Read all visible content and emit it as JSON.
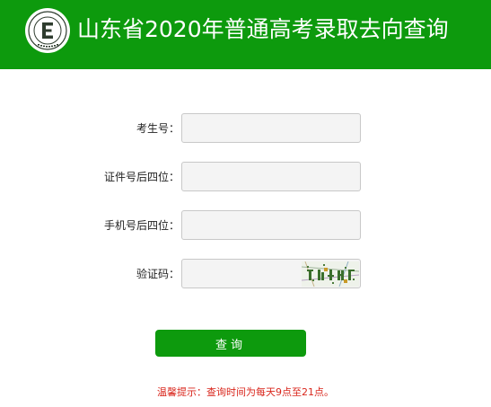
{
  "header": {
    "title": "山东省2020年普通高考录取去向查询",
    "logo_icon": "exam-authority-logo",
    "background_color": "#0d9a0d"
  },
  "form": {
    "fields": [
      {
        "label": "考生号：",
        "value": ""
      },
      {
        "label": "证件号后四位：",
        "value": ""
      },
      {
        "label": "手机号后四位：",
        "value": ""
      },
      {
        "label": "验证码：",
        "value": ""
      }
    ],
    "captcha_icon": "captcha-image"
  },
  "submit_label": "查询",
  "notice": "温馨提示：查询时间为每天9点至21点。",
  "colors": {
    "accent": "#0d9a0d",
    "notice": "#d9261c",
    "input_background": "#f4f4f4"
  }
}
